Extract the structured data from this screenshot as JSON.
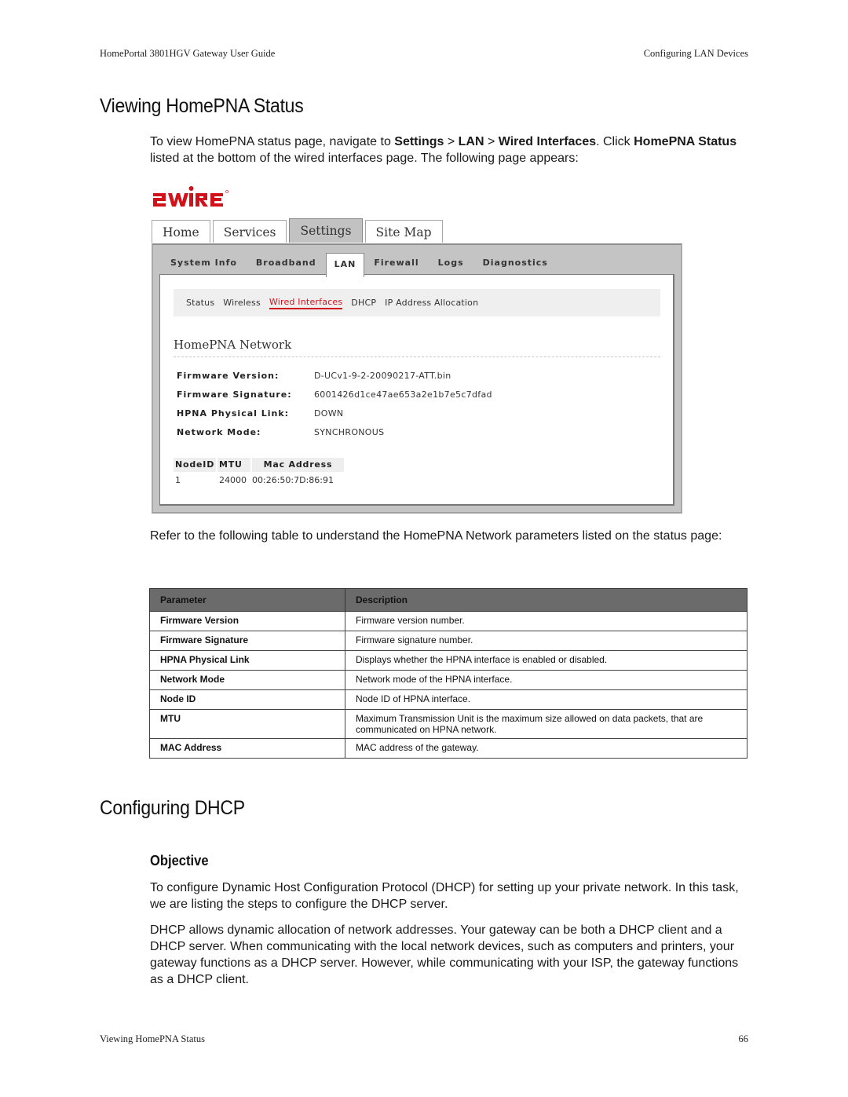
{
  "running_header": {
    "left": "HomePortal 3801HGV Gateway User Guide",
    "right": "Configuring LAN Devices"
  },
  "section1": {
    "title": "Viewing HomePNA Status",
    "intro": {
      "t1": "To view HomePNA status page, navigate to ",
      "b1": "Settings",
      "t2": " > ",
      "b2": "LAN",
      "t3": " > ",
      "b3": "Wired Interfaces",
      "t4": ". Click ",
      "b4": "HomePNA Status",
      "t5": " listed at the bottom of the wired interfaces page. The following page appears:"
    }
  },
  "screenshot": {
    "logo_text": "2WIRE",
    "logo_color": "#d1121b",
    "main_tabs": [
      {
        "label": "Home",
        "active": false
      },
      {
        "label": "Services",
        "active": false
      },
      {
        "label": "Settings",
        "active": true
      },
      {
        "label": "Site Map",
        "active": false
      }
    ],
    "sub_tabs": [
      {
        "label": "System Info",
        "active": false
      },
      {
        "label": "Broadband",
        "active": false
      },
      {
        "label": "LAN",
        "active": true
      },
      {
        "label": "Firewall",
        "active": false
      },
      {
        "label": "Logs",
        "active": false
      },
      {
        "label": "Diagnostics",
        "active": false
      }
    ],
    "sub_links": [
      {
        "label": "Status",
        "active": false
      },
      {
        "label": "Wireless",
        "active": false
      },
      {
        "label": "Wired Interfaces",
        "active": true
      },
      {
        "label": "DHCP",
        "active": false
      },
      {
        "label": "IP Address Allocation",
        "active": false
      }
    ],
    "section_title": "HomePNA Network",
    "fields": [
      {
        "label": "Firmware Version:",
        "value": "D-UCv1-9-2-20090217-ATT.bin"
      },
      {
        "label": "Firmware Signature:",
        "value": "6001426d1ce47ae653a2e1b7e5c7dfad"
      },
      {
        "label": "HPNA Physical Link:",
        "value": "DOWN"
      },
      {
        "label": "Network Mode:",
        "value": "SYNCHRONOUS"
      }
    ],
    "node_table": {
      "headers": [
        "NodeID",
        "MTU",
        "Mac Address"
      ],
      "rows": [
        [
          "1",
          "24000",
          "00:26:50:7D:86:91"
        ]
      ]
    }
  },
  "refer_text": "Refer to the following table to understand the HomePNA Network parameters listed on the status page:",
  "param_table": {
    "headers": [
      "Parameter",
      "Description"
    ],
    "rows": [
      {
        "param": "Firmware Version",
        "desc": "Firmware version number."
      },
      {
        "param": "Firmware Signature",
        "desc": "Firmware signature number."
      },
      {
        "param": "HPNA Physical Link",
        "desc": "Displays whether the HPNA interface is enabled or disabled."
      },
      {
        "param": "Network Mode",
        "desc": "Network mode of the HPNA interface."
      },
      {
        "param": "Node ID",
        "desc": "Node ID of HPNA interface."
      },
      {
        "param": "MTU",
        "desc": "Maximum Transmission Unit is the maximum size allowed on data packets, that are communicated on HPNA network."
      },
      {
        "param": "MAC Address",
        "desc": "MAC address of the gateway."
      }
    ]
  },
  "section2": {
    "title": "Configuring DHCP",
    "subtitle": "Objective",
    "para1": "To configure Dynamic Host Configuration Protocol (DHCP) for setting up your private network. In this task, we are listing the steps to configure the DHCP server.",
    "para2": "DHCP allows dynamic allocation of network addresses. Your gateway can be both a DHCP client and a DHCP server. When communicating with the local network devices, such as computers and printers, your gateway functions as a DHCP server. However, while communicating with your ISP, the gateway functions as a DHCP client."
  },
  "footer": {
    "left": "Viewing HomePNA Status",
    "page_number": "66"
  }
}
